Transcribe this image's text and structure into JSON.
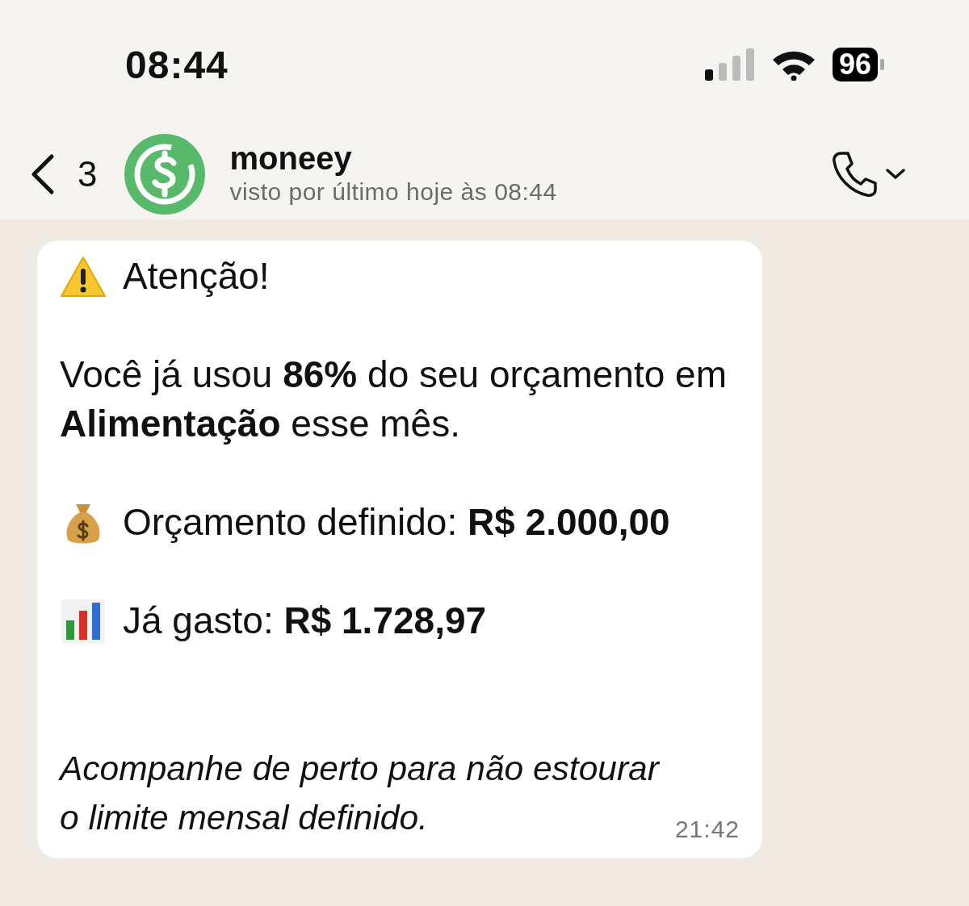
{
  "status_bar": {
    "time": "08:44",
    "battery": "96"
  },
  "header": {
    "back_count": "3",
    "name": "moneey",
    "status": "visto por último hoje às 08:44"
  },
  "message": {
    "lines": [
      {
        "kind": "alert",
        "text": "Atenção!"
      },
      {
        "kind": "paragraph",
        "text": "Você já usou **86%** do seu orçamento em **Alimentação** esse mês."
      },
      {
        "kind": "budget",
        "text": "Orçamento definido: **R$ 2.000,00**"
      },
      {
        "kind": "spent",
        "text": "Já gasto: **R$ 1.728,97**"
      },
      {
        "kind": "note",
        "text": "Acompanhe de perto para não estourar o limite mensal definido."
      }
    ],
    "time": "21:42"
  }
}
